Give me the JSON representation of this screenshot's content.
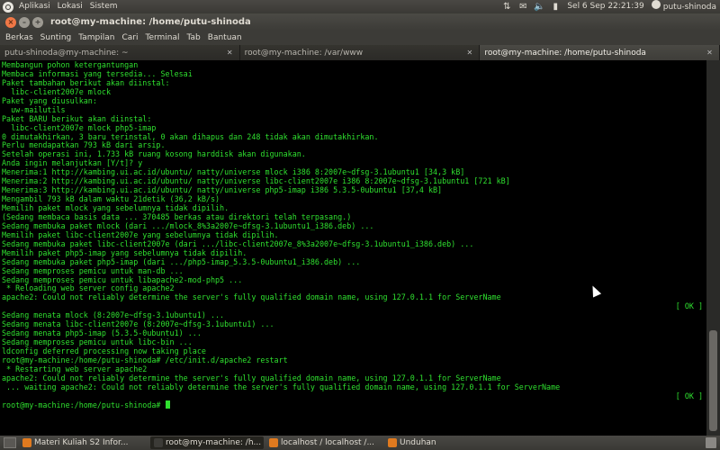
{
  "top_panel": {
    "menus": [
      "Aplikasi",
      "Lokasi",
      "Sistem"
    ],
    "clock": "Sel 6 Sep 22:21:39",
    "user": "putu-shinoda",
    "icons": [
      "network-arrows-icon",
      "email-icon",
      "volume-icon",
      "battery-icon"
    ]
  },
  "window": {
    "title": "root@my-machine: /home/putu-shinoda",
    "menubar": [
      "Berkas",
      "Sunting",
      "Tampilan",
      "Cari",
      "Terminal",
      "Tab",
      "Bantuan"
    ],
    "tabs": [
      {
        "label": "putu-shinoda@my-machine: ~",
        "active": false
      },
      {
        "label": "root@my-machine: /var/www",
        "active": false
      },
      {
        "label": "root@my-machine: /home/putu-shinoda",
        "active": true
      }
    ]
  },
  "terminal": {
    "lines": [
      {
        "text": "Membangun pohon ketergantungan"
      },
      {
        "text": "Membaca informasi yang tersedia... Selesai"
      },
      {
        "text": "Paket tambahan berikut akan diinstal:"
      },
      {
        "text": "  libc-client2007e mlock"
      },
      {
        "text": "Paket yang diusulkan:"
      },
      {
        "text": "  uw-mailutils"
      },
      {
        "text": "Paket BARU berikut akan diinstal:"
      },
      {
        "text": "  libc-client2007e mlock php5-imap"
      },
      {
        "text": "0 dimutakhirkan, 3 baru terinstal, 0 akan dihapus dan 248 tidak akan dimutakhirkan."
      },
      {
        "text": "Perlu mendapatkan 793 kB dari arsip."
      },
      {
        "text": "Setelah operasi ini, 1.733 kB ruang kosong harddisk akan digunakan."
      },
      {
        "text": "Anda ingin melanjutkan [Y/t]? y"
      },
      {
        "text": "Menerima:1 http://kambing.ui.ac.id/ubuntu/ natty/universe mlock i386 8:2007e~dfsg-3.1ubuntu1 [34,3 kB]"
      },
      {
        "text": "Menerima:2 http://kambing.ui.ac.id/ubuntu/ natty/universe libc-client2007e i386 8:2007e~dfsg-3.1ubuntu1 [721 kB]"
      },
      {
        "text": "Menerima:3 http://kambing.ui.ac.id/ubuntu/ natty/universe php5-imap i386 5.3.5-0ubuntu1 [37,4 kB]"
      },
      {
        "text": "Mengambil 793 kB dalam waktu 21detik (36,2 kB/s)"
      },
      {
        "text": "Memilih paket mlock yang sebelumnya tidak dipilih."
      },
      {
        "text": "(Sedang membaca basis data ... 370485 berkas atau direktori telah terpasang.)"
      },
      {
        "text": "Sedang membuka paket mlock (dari .../mlock_8%3a2007e~dfsg-3.1ubuntu1_i386.deb) ..."
      },
      {
        "text": "Memilih paket libc-client2007e yang sebelumnya tidak dipilih."
      },
      {
        "text": "Sedang membuka paket libc-client2007e (dari .../libc-client2007e_8%3a2007e~dfsg-3.1ubuntu1_i386.deb) ..."
      },
      {
        "text": "Memilih paket php5-imap yang sebelumnya tidak dipilih."
      },
      {
        "text": "Sedang membuka paket php5-imap (dari .../php5-imap_5.3.5-0ubuntu1_i386.deb) ..."
      },
      {
        "text": "Sedang memproses pemicu untuk man-db ..."
      },
      {
        "text": "Sedang memproses pemicu untuk libapache2-mod-php5 ..."
      },
      {
        "text": " * Reloading web server config apache2"
      },
      {
        "text": "apache2: Could not reliably determine the server's fully qualified domain name, using 127.0.1.1 for ServerName"
      },
      {
        "text": "",
        "ok": "[ OK ]"
      },
      {
        "text": "Sedang menata mlock (8:2007e~dfsg-3.1ubuntu1) ..."
      },
      {
        "text": "Sedang menata libc-client2007e (8:2007e~dfsg-3.1ubuntu1) ..."
      },
      {
        "text": "Sedang menata php5-imap (5.3.5-0ubuntu1) ..."
      },
      {
        "text": "Sedang memproses pemicu untuk libc-bin ..."
      },
      {
        "text": "ldconfig deferred processing now taking place"
      },
      {
        "text": "root@my-machine:/home/putu-shinoda# /etc/init.d/apache2 restart"
      },
      {
        "text": " * Restarting web server apache2"
      },
      {
        "text": "apache2: Could not reliably determine the server's fully qualified domain name, using 127.0.1.1 for ServerName"
      },
      {
        "text": " ... waiting apache2: Could not reliably determine the server's fully qualified domain name, using 127.0.1.1 for ServerName"
      },
      {
        "text": "",
        "ok": "[ OK ]"
      },
      {
        "text": "root@my-machine:/home/putu-shinoda# ",
        "cursor": true
      }
    ]
  },
  "taskbar": {
    "items": [
      {
        "label": "Materi Kuliah S2 Infor...",
        "icon_color": "#e07a1f",
        "active": false
      },
      {
        "label": "root@my-machine: /h...",
        "icon_color": "#3c3b37",
        "active": true
      },
      {
        "label": "localhost / localhost /...",
        "icon_color": "#e07a1f",
        "active": false
      },
      {
        "label": "Unduhan",
        "icon_color": "#e07a1f",
        "active": false
      }
    ]
  },
  "colors": {
    "terminal_text": "#2fe02f",
    "terminal_bg": "#000000",
    "close_button": "#f07746"
  }
}
